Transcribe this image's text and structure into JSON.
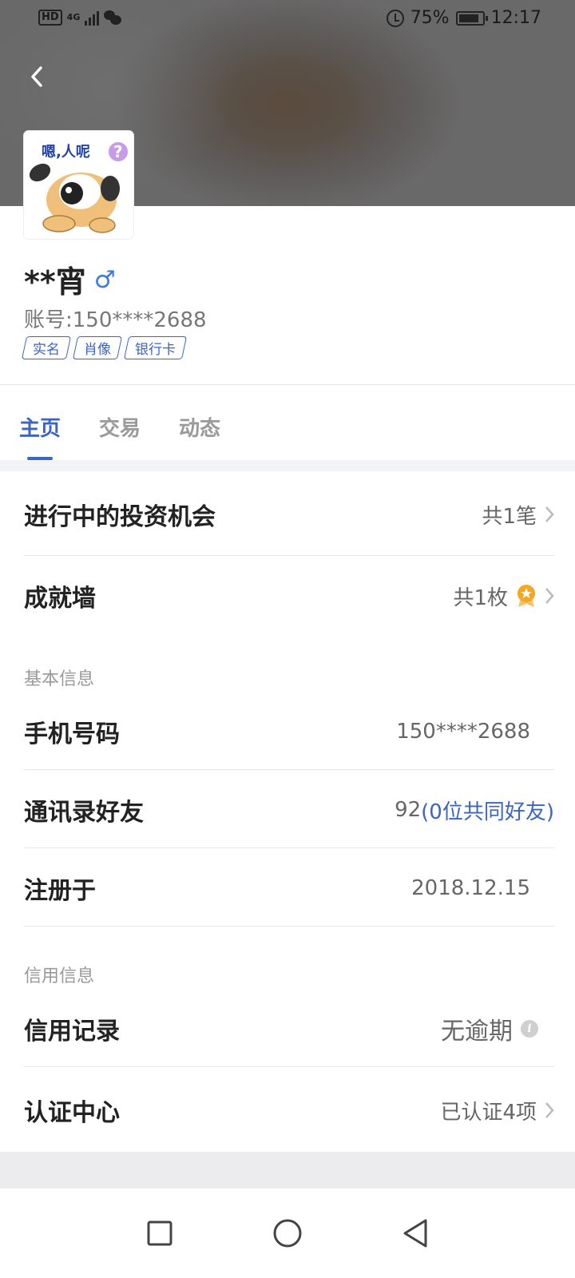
{
  "status_bar": {
    "network_hd": "HD",
    "network_type": "4G",
    "battery_percent": "75%",
    "time": "12:17"
  },
  "profile": {
    "name": "**宵",
    "gender_symbol": "♂",
    "account": "账号:150****2688",
    "tags": [
      "实名",
      "肖像",
      "银行卡"
    ]
  },
  "tabs": [
    "主页",
    "交易",
    "动态"
  ],
  "active_tab": "主页",
  "sections": {
    "investment": {
      "label": "进行中的投资机会",
      "value": "共1笔"
    },
    "achievement": {
      "label": "成就墙",
      "value": "共1枚"
    },
    "basic_title": "基本信息",
    "phone": {
      "label": "手机号码",
      "value": "150****2688"
    },
    "contacts": {
      "label": "通讯录好友",
      "count": "92",
      "mutual": "(0位共同好友)"
    },
    "register": {
      "label": "注册于",
      "value": "2018.12.15"
    },
    "credit_title": "信用信息",
    "credit_record": {
      "label": "信用记录",
      "value": "无逾期"
    },
    "certification": {
      "label": "认证中心",
      "value": "已认证4项"
    }
  },
  "colors": {
    "accent": "#3a64c8",
    "gender": "#3a7be0",
    "medal": "#f5a623"
  }
}
